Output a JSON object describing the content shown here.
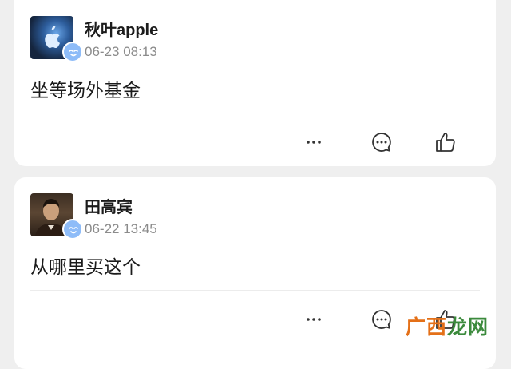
{
  "comments": [
    {
      "username": "秋叶apple",
      "time": "06-23 08:13",
      "content": "坐等场外基金",
      "actions": [
        "more-icon",
        "comment-icon",
        "like-icon"
      ]
    },
    {
      "username": "田高宾",
      "time": "06-22 13:45",
      "content": "从哪里买这个",
      "actions": [
        "more-icon",
        "comment-icon",
        "like-icon"
      ]
    }
  ],
  "more_label": "···",
  "watermark": {
    "part1": "广西",
    "part2": "龙网"
  },
  "colors": {
    "badge": "#8ebcf8",
    "watermark_orange": "#e47018",
    "watermark_green": "#3b8a3c"
  }
}
